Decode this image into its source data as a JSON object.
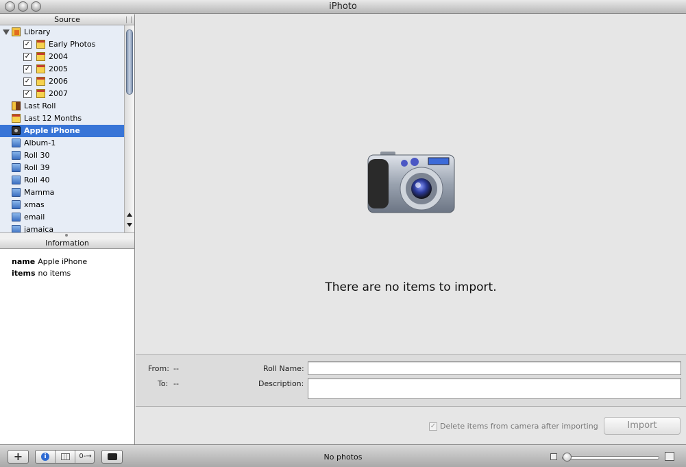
{
  "window": {
    "title": "iPhoto"
  },
  "source": {
    "header": "Source",
    "items": [
      {
        "label": "Library",
        "icon": "library-icon"
      },
      {
        "label": "Early Photos",
        "icon": "calendar-icon",
        "checked": true
      },
      {
        "label": "2004",
        "icon": "calendar-icon",
        "checked": true
      },
      {
        "label": "2005",
        "icon": "calendar-icon",
        "checked": true
      },
      {
        "label": "2006",
        "icon": "calendar-icon",
        "checked": true
      },
      {
        "label": "2007",
        "icon": "calendar-icon",
        "checked": true
      },
      {
        "label": "Last Roll",
        "icon": "film-roll-icon"
      },
      {
        "label": "Last 12 Months",
        "icon": "calendar-icon"
      },
      {
        "label": "Apple iPhone",
        "icon": "camera-icon",
        "selected": true
      },
      {
        "label": "Album-1",
        "icon": "album-icon"
      },
      {
        "label": "Roll 30",
        "icon": "album-icon"
      },
      {
        "label": "Roll 39",
        "icon": "album-icon"
      },
      {
        "label": "Roll 40",
        "icon": "album-icon"
      },
      {
        "label": "Mamma",
        "icon": "album-icon"
      },
      {
        "label": "xmas",
        "icon": "album-icon"
      },
      {
        "label": "email",
        "icon": "album-icon"
      },
      {
        "label": "jamaica",
        "icon": "album-icon"
      }
    ]
  },
  "information": {
    "header": "Information",
    "name_key": "name",
    "name_value": "Apple iPhone",
    "items_key": "items",
    "items_value": "no items"
  },
  "main": {
    "message": "There are no items to import."
  },
  "import_form": {
    "from_label": "From:",
    "from_value": "--",
    "to_label": "To:",
    "to_value": "--",
    "roll_name_label": "Roll Name:",
    "roll_name_value": "",
    "description_label": "Description:",
    "description_value": ""
  },
  "actions": {
    "delete_label": "Delete items from camera after importing",
    "delete_checked": true,
    "import_button": "Import"
  },
  "toolbar": {
    "add_icon": "plus-icon",
    "info_icon": "info-icon",
    "calendar_icon": "calendar-view-icon",
    "keyword_icon": "key-icon",
    "fullscreen_icon": "fullscreen-icon",
    "status": "No photos",
    "add_label": "+",
    "key_label": "0-→"
  }
}
